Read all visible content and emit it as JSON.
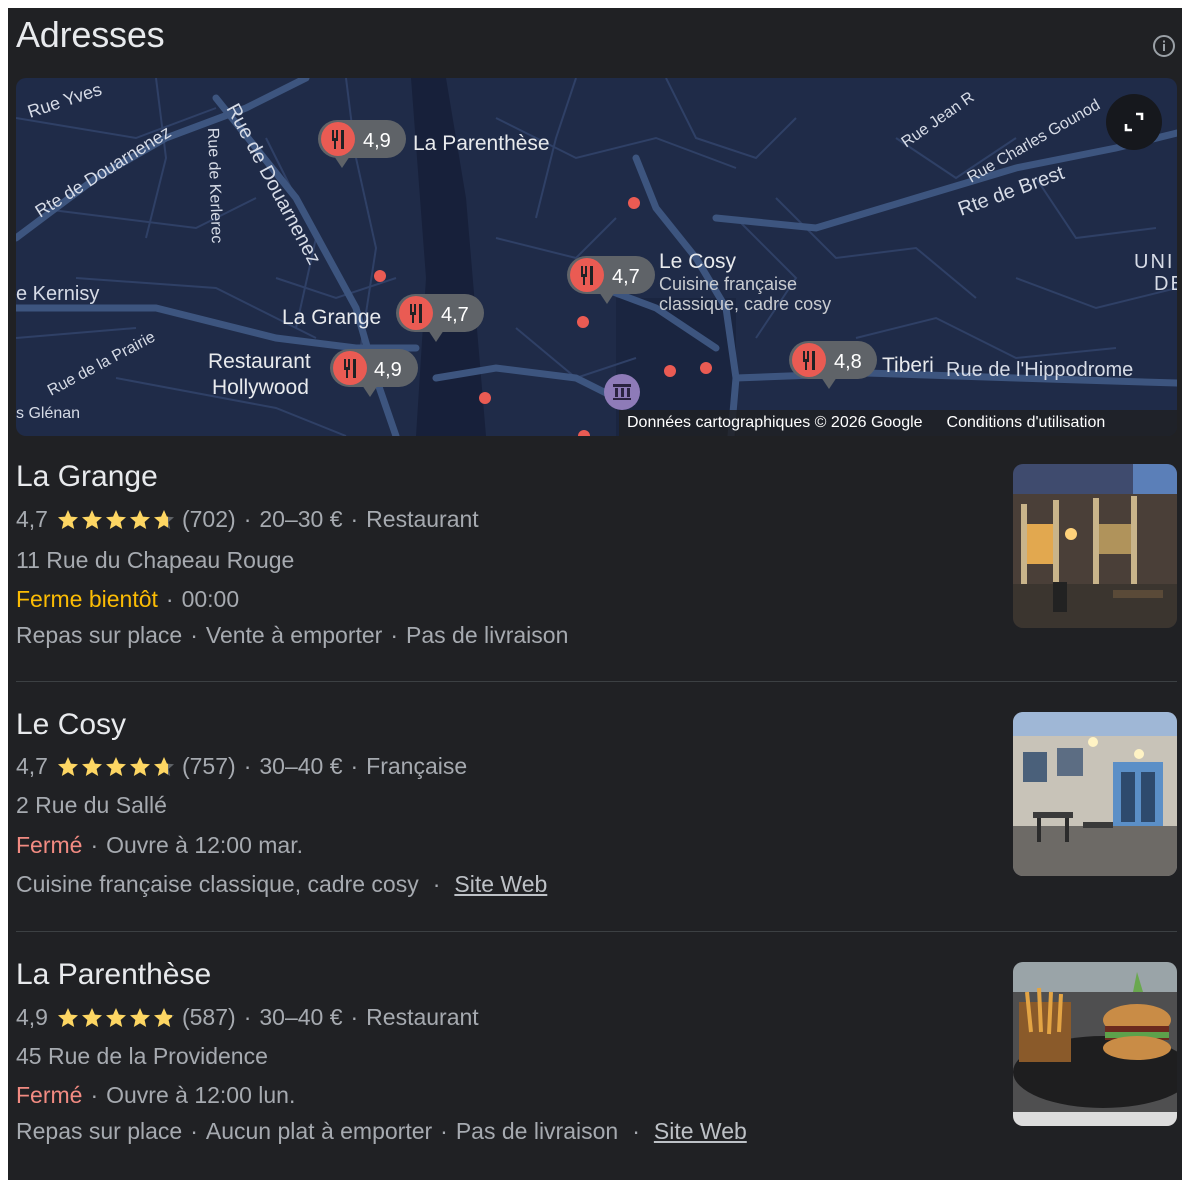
{
  "header": {
    "title": "Adresses"
  },
  "map": {
    "streets": [
      "Rue Yves",
      "Rte de Douarnenez",
      "Rue de Douarnenez",
      "Rue de Kerlerec",
      "Rue Jean R",
      "Rue Charles Gounod",
      "Rte de Brest",
      "e Kernisy",
      "Rue de la Prairie",
      "s Glénan",
      "Rue de l'Hippodrome",
      "UNI",
      "DE"
    ],
    "pins": [
      {
        "rating": "4,9",
        "label": "La Parenthèse"
      },
      {
        "rating": "4,7",
        "label": "La Grange"
      },
      {
        "rating": "4,9",
        "label_line1": "Restaurant",
        "label_line2": "Hollywood"
      },
      {
        "rating": "4,7",
        "label": "Le Cosy",
        "sub1": "Cuisine française",
        "sub2": "classique, cadre cosy"
      },
      {
        "rating": "4,8",
        "label": "Tiberi"
      }
    ],
    "attribution": "Données cartographiques © 2026 Google",
    "terms": "Conditions d'utilisation"
  },
  "results": [
    {
      "name": "La Grange",
      "rating": "4,7",
      "stars": 4.7,
      "reviews": "(702)",
      "price": "20–30 €",
      "category": "Restaurant",
      "address": "11 Rue du Chapeau Rouge",
      "status": "Ferme bientôt",
      "hours": "00:00",
      "services": [
        "Repas sur place",
        "Vente à emporter",
        "Pas de livraison"
      ]
    },
    {
      "name": "Le Cosy",
      "rating": "4,7",
      "stars": 4.7,
      "reviews": "(757)",
      "price": "30–40 €",
      "category": "Française",
      "address": "2 Rue du Sallé",
      "status": "Fermé",
      "hours": "Ouvre à 12:00 mar.",
      "description": "Cuisine française classique, cadre cosy",
      "website": "Site Web"
    },
    {
      "name": "La Parenthèse",
      "rating": "4,9",
      "stars": 4.9,
      "reviews": "(587)",
      "price": "30–40 €",
      "category": "Restaurant",
      "address": "45 Rue de la Providence",
      "status": "Fermé",
      "hours": "Ouvre à 12:00 lun.",
      "services": [
        "Repas sur place",
        "Aucun plat à emporter",
        "Pas de livraison"
      ],
      "website": "Site Web"
    }
  ],
  "colors": {
    "background": "#202124",
    "map_bg": "#1f2b48",
    "pin_red": "#ea5b53",
    "warning": "#fbbc04",
    "closed": "#f28b82",
    "star": "#fdd663"
  },
  "icons": [
    "info-icon",
    "expand-icon",
    "restaurant-icon",
    "museum-icon",
    "star-icon"
  ]
}
